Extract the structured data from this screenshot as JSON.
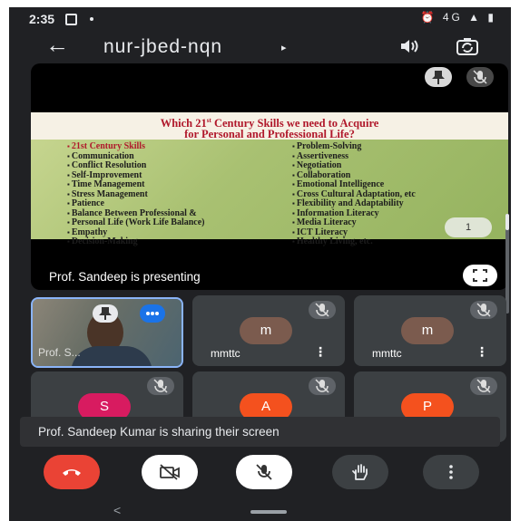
{
  "status": {
    "time": "2:35",
    "right_icons": "⏰ 4G ▲ ▮"
  },
  "header": {
    "back_glyph": "←",
    "meeting_code": "nur-jbed-nqn",
    "caret": "▸"
  },
  "slide": {
    "title_line1_pre": "Which 21",
    "title_sup": "st",
    "title_line1_post": " Century Skills we need to Acquire",
    "title_line2": "for Personal and Professional Life?",
    "left_items": [
      "21st Century Skills",
      "Communication",
      "Conflict Resolution",
      "Self-Improvement",
      "Time Management",
      "Stress Management",
      "Patience",
      "Balance Between Professional &",
      "Personal Life (Work Life Balance)",
      "Empathy",
      "Decision-Making"
    ],
    "right_items": [
      "Problem-Solving",
      "Assertiveness",
      "Negotiation",
      "Collaboration",
      "Emotional Intelligence",
      "Cross Cultural Adaptation, etc",
      "Flexibility and Adaptability",
      "Information Literacy",
      "Media Literacy",
      "ICT Literacy",
      "Healthy Living, etc."
    ],
    "page": "1"
  },
  "presenting_text": "Prof. Sandeep is presenting",
  "self_label": "Prof. S...",
  "tiles": [
    {
      "initial": "m",
      "name": "mmttc",
      "color": "#7b5b4e"
    },
    {
      "initial": "m",
      "name": "mmttc",
      "color": "#7b5b4e"
    },
    {
      "initial": "S",
      "color": "#d81b60"
    },
    {
      "initial": "A",
      "color": "#f4511e"
    },
    {
      "initial": "P",
      "color": "#f4511e"
    }
  ],
  "toast": "Prof. Sandeep Kumar is sharing their screen",
  "more_glyph": "⋮",
  "nav_back": "<"
}
